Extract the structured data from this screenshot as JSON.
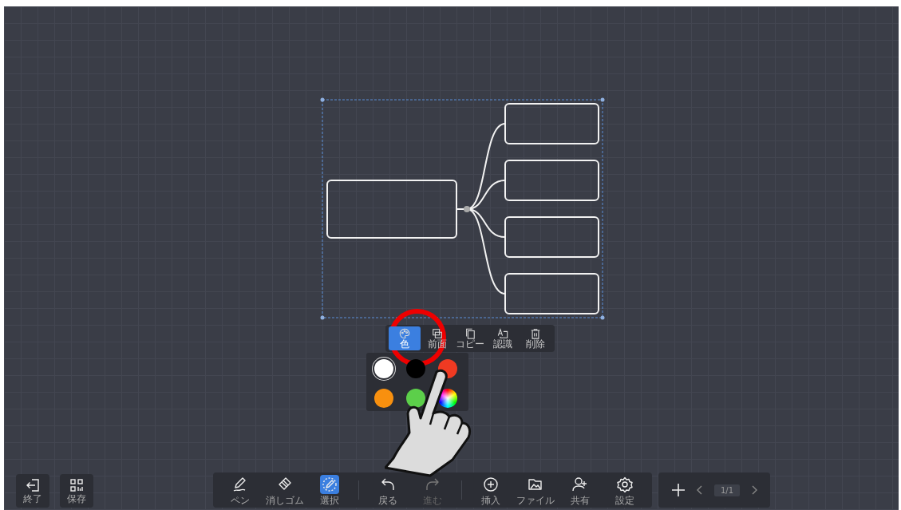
{
  "left_buttons": [
    {
      "label": "終了"
    },
    {
      "label": "保存"
    }
  ],
  "context_menu": [
    {
      "label": "色",
      "selected": true
    },
    {
      "label": "前面",
      "selected": false
    },
    {
      "label": "コピー",
      "selected": false
    },
    {
      "label": "認識",
      "selected": false
    },
    {
      "label": "削除",
      "selected": false
    }
  ],
  "palette": [
    {
      "kind": "solid",
      "color": "#ffffff",
      "selected": true
    },
    {
      "kind": "solid",
      "color": "#000000",
      "selected": false
    },
    {
      "kind": "solid",
      "color": "#f03a22",
      "selected": false
    },
    {
      "kind": "solid",
      "color": "#f8900f",
      "selected": false
    },
    {
      "kind": "solid",
      "color": "#5ccf4a",
      "selected": false
    },
    {
      "kind": "spectrum",
      "selected": false
    }
  ],
  "toolbar": [
    {
      "label": "ペン",
      "selected": false,
      "disabled": false
    },
    {
      "label": "消しゴム",
      "selected": false,
      "disabled": false
    },
    {
      "label": "選択",
      "selected": true,
      "disabled": false
    },
    {
      "label": "戻る",
      "selected": false,
      "disabled": false
    },
    {
      "label": "進む",
      "selected": false,
      "disabled": true
    },
    {
      "label": "挿入",
      "selected": false,
      "disabled": false
    },
    {
      "label": "ファイル",
      "selected": false,
      "disabled": false
    },
    {
      "label": "共有",
      "selected": false,
      "disabled": false
    },
    {
      "label": "設定",
      "selected": false,
      "disabled": false
    }
  ],
  "page_indicator": "1/1"
}
